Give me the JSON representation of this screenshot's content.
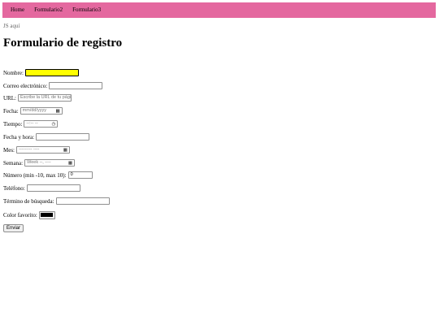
{
  "nav": {
    "items": [
      "Home",
      "Formulario2",
      "Formulario3"
    ]
  },
  "js_note": "JS aquí",
  "page_title": "Formulario de registro",
  "form": {
    "nombre_label": "Nombre:",
    "nombre_value": "",
    "correo_label": "Correo electrónico:",
    "correo_value": "",
    "url_label": "URL:",
    "url_placeholder": "Escribe la URL de tu página",
    "fecha_label": "Fecha:",
    "fecha_value": "mm/dd/yyyy",
    "tiempo_label": "Tiempo:",
    "tiempo_value": "--:-- --",
    "fecha_hora_label": "Fecha y hora:",
    "fecha_hora_value": "",
    "mes_label": "Mes:",
    "mes_value": "--------- ----",
    "semana_label": "Semana:",
    "semana_value": "Week --, ----",
    "numero_label": "Número (min -10, max 10):",
    "numero_value": "0",
    "telefono_label": "Teléfono:",
    "telefono_value": "",
    "busqueda_label": "Término de búsqueda:",
    "busqueda_value": "",
    "color_label": "Color favorito:",
    "color_value": "#000000",
    "submit_label": "Enviar"
  }
}
